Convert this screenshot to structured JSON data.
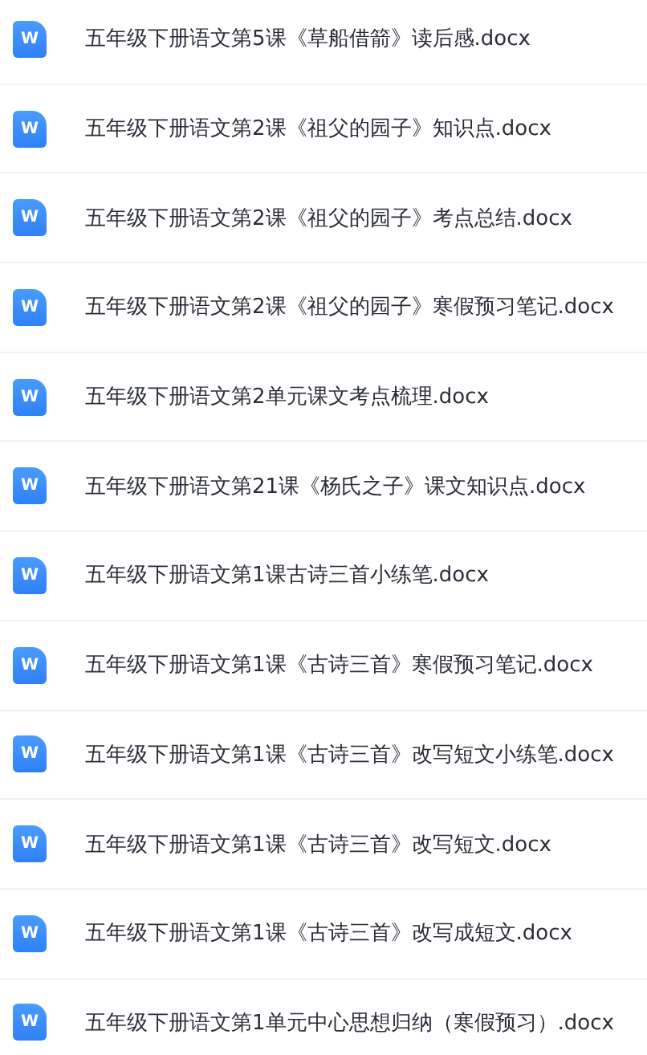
{
  "files": [
    {
      "name": "五年级下册语文第5课《草船借箭》读后感.docx",
      "icon_letter": "W"
    },
    {
      "name": "五年级下册语文第2课《祖父的园子》知识点.docx",
      "icon_letter": "W"
    },
    {
      "name": "五年级下册语文第2课《祖父的园子》考点总结.docx",
      "icon_letter": "W"
    },
    {
      "name": "五年级下册语文第2课《祖父的园子》寒假预习笔记.docx",
      "icon_letter": "W"
    },
    {
      "name": "五年级下册语文第2单元课文考点梳理.docx",
      "icon_letter": "W"
    },
    {
      "name": "五年级下册语文第21课《杨氏之子》课文知识点.docx",
      "icon_letter": "W"
    },
    {
      "name": "五年级下册语文第1课古诗三首小练笔.docx",
      "icon_letter": "W"
    },
    {
      "name": "五年级下册语文第1课《古诗三首》寒假预习笔记.docx",
      "icon_letter": "W"
    },
    {
      "name": "五年级下册语文第1课《古诗三首》改写短文小练笔.docx",
      "icon_letter": "W"
    },
    {
      "name": "五年级下册语文第1课《古诗三首》改写短文.docx",
      "icon_letter": "W"
    },
    {
      "name": "五年级下册语文第1课《古诗三首》改写成短文.docx",
      "icon_letter": "W"
    },
    {
      "name": "五年级下册语文第1单元中心思想归纳（寒假预习）.docx",
      "icon_letter": "W"
    }
  ]
}
